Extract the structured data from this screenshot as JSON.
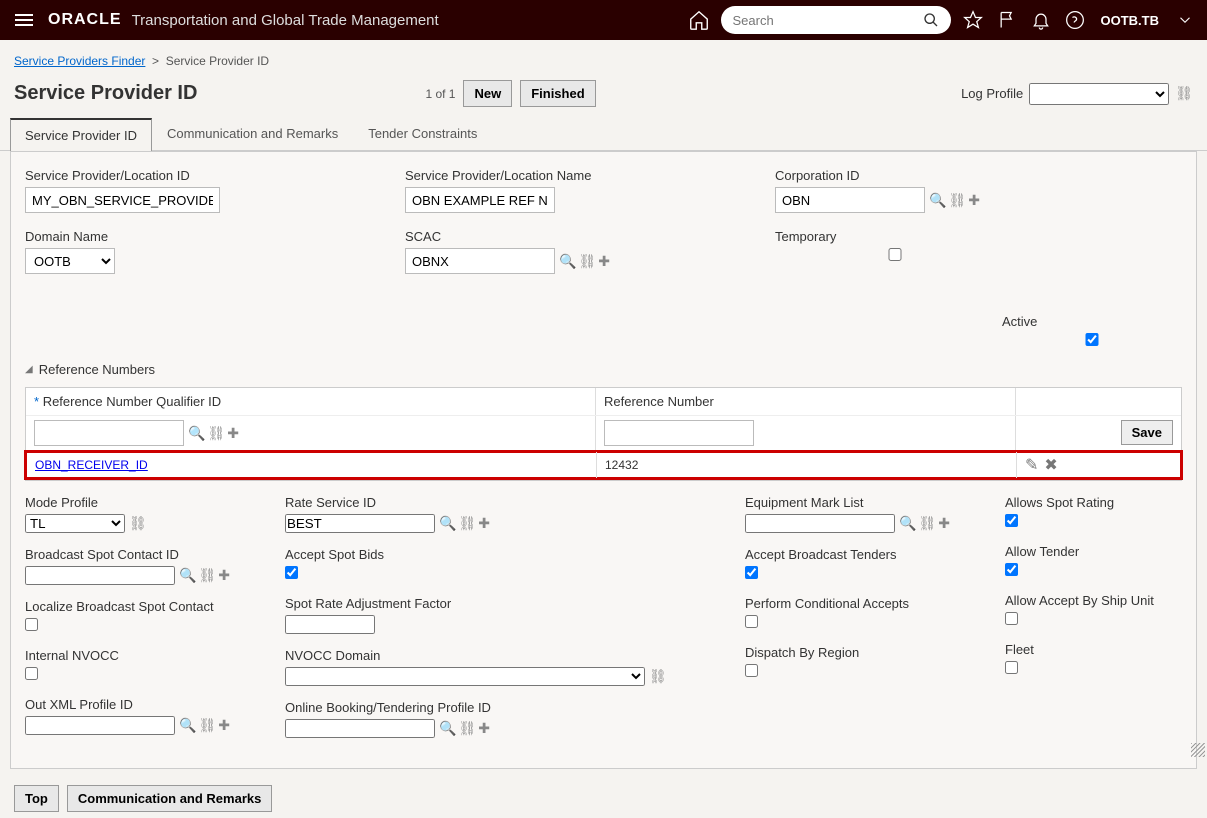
{
  "header": {
    "logo": "ORACLE",
    "app_title": "Transportation and Global Trade Management",
    "search_placeholder": "Search",
    "user": "OOTB.TB"
  },
  "breadcrumb": {
    "root_label": "Service Providers Finder",
    "current": "Service Provider ID"
  },
  "page": {
    "title": "Service Provider ID",
    "counter": "1 of 1",
    "new_btn": "New",
    "finished_btn": "Finished",
    "log_profile_label": "Log Profile"
  },
  "tabs": [
    {
      "label": "Service Provider ID",
      "active": true
    },
    {
      "label": "Communication and Remarks",
      "active": false
    },
    {
      "label": "Tender Constraints",
      "active": false
    }
  ],
  "form": {
    "sp_location_id": {
      "label": "Service Provider/Location ID",
      "value": "MY_OBN_SERVICE_PROVIDER"
    },
    "sp_location_name": {
      "label": "Service Provider/Location Name",
      "value": "OBN EXAMPLE REF NUM"
    },
    "corp_id": {
      "label": "Corporation ID",
      "value": "OBN"
    },
    "domain_name": {
      "label": "Domain Name",
      "value": "OOTB"
    },
    "scac": {
      "label": "SCAC",
      "value": "OBNX"
    },
    "temporary": {
      "label": "Temporary",
      "checked": false
    },
    "active": {
      "label": "Active",
      "checked": true
    },
    "ref_section": "Reference Numbers",
    "ref_qual_header": "Reference Number Qualifier ID",
    "ref_num_header": "Reference Number",
    "save_btn": "Save",
    "ref_row": {
      "qual": "OBN_RECEIVER_ID",
      "num": "12432"
    },
    "mode_profile": {
      "label": "Mode Profile",
      "value": "TL"
    },
    "rate_service_id": {
      "label": "Rate Service ID",
      "value": "BEST"
    },
    "equipment_mark": {
      "label": "Equipment Mark List",
      "value": ""
    },
    "allows_spot": {
      "label": "Allows Spot Rating",
      "checked": true
    },
    "broadcast_contact": {
      "label": "Broadcast Spot Contact ID",
      "value": ""
    },
    "accept_spot": {
      "label": "Accept Spot Bids",
      "checked": true
    },
    "accept_broadcast": {
      "label": "Accept Broadcast Tenders",
      "checked": true
    },
    "allow_tender": {
      "label": "Allow Tender",
      "checked": true
    },
    "localize_broadcast": {
      "label": "Localize Broadcast Spot Contact",
      "checked": false
    },
    "spot_rate_adj": {
      "label": "Spot Rate Adjustment Factor",
      "value": ""
    },
    "perform_cond": {
      "label": "Perform Conditional Accepts",
      "checked": false
    },
    "allow_ship_unit": {
      "label": "Allow Accept By Ship Unit",
      "checked": false
    },
    "internal_nvocc": {
      "label": "Internal NVOCC",
      "checked": false
    },
    "nvocc_domain": {
      "label": "NVOCC Domain",
      "value": ""
    },
    "dispatch_region": {
      "label": "Dispatch By Region",
      "checked": false
    },
    "fleet": {
      "label": "Fleet",
      "checked": false
    },
    "out_xml": {
      "label": "Out XML Profile ID",
      "value": ""
    },
    "online_booking": {
      "label": "Online Booking/Tendering Profile ID",
      "value": ""
    }
  },
  "bottom": {
    "top_btn": "Top",
    "comm_btn": "Communication and Remarks"
  }
}
